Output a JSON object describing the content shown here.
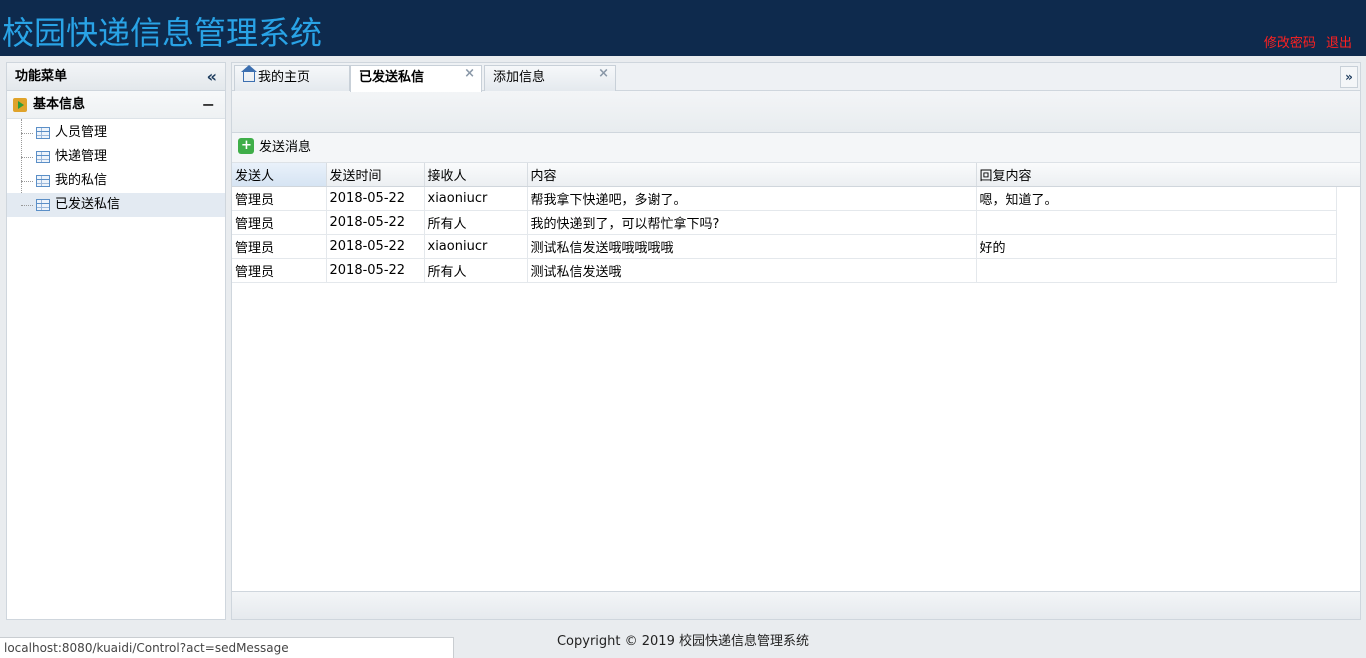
{
  "header": {
    "title": "校园快递信息管理系统",
    "change_password": "修改密码",
    "logout": "退出",
    "link_color": "#ff2020",
    "title_color": "#29a3e6"
  },
  "sidebar": {
    "title": "功能菜单",
    "group": "基本信息",
    "items": [
      {
        "label": "人员管理"
      },
      {
        "label": "快递管理"
      },
      {
        "label": "我的私信"
      },
      {
        "label": "已发送私信"
      }
    ]
  },
  "tabs": [
    {
      "label": "我的主页"
    },
    {
      "label": "已发送私信"
    },
    {
      "label": "添加信息"
    }
  ],
  "toolbar": {
    "send_label": "发送消息"
  },
  "table": {
    "columns": [
      "发送人",
      "发送时间",
      "接收人",
      "内容",
      "回复内容"
    ],
    "rows": [
      [
        "管理员",
        "2018-05-22",
        "xiaoniucr",
        "帮我拿下快递吧，多谢了。",
        "嗯，知道了。"
      ],
      [
        "管理员",
        "2018-05-22",
        "所有人",
        "我的快递到了，可以帮忙拿下吗?",
        ""
      ],
      [
        "管理员",
        "2018-05-22",
        "xiaoniucr",
        "测试私信发送哦哦哦哦哦",
        "好的"
      ],
      [
        "管理员",
        "2018-05-22",
        "所有人",
        "测试私信发送哦",
        ""
      ]
    ]
  },
  "footer": {
    "copyright": "Copyright © 2019 校园快递信息管理系统"
  },
  "status": {
    "url": "localhost:8080/kuaidi/Control?act=sedMessage"
  }
}
